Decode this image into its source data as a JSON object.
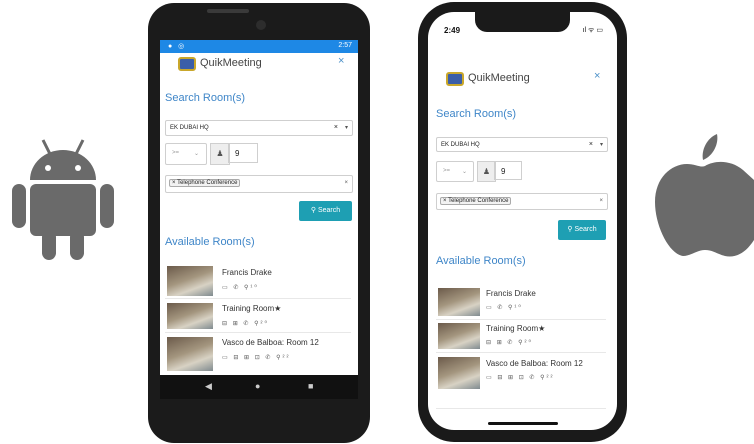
{
  "colors": {
    "accent": "#3f86c8",
    "button": "#1e9fb3",
    "android_status": "#1e88e5"
  },
  "android": {
    "status_time": "2:57",
    "app": {
      "brand": "QuikMeeting",
      "close": "×",
      "search_title": "Search Room(s)",
      "location": "EK DUBAI HQ",
      "operator": ">=",
      "capacity": "9",
      "amenity_chip": "× Telephone Conference",
      "search_button": "Search",
      "available_title": "Available Room(s)",
      "rooms": [
        {
          "name": "Francis Drake",
          "amenities": "▭ ✆ ⚲¹⁰"
        },
        {
          "name": "Training Room★",
          "amenities": "⊟ ⊞ ✆ ⚲²⁰"
        },
        {
          "name": "Vasco de Balboa: Room 12",
          "amenities": "▭ ⊟ ⊞ ⊡ ✆ ⚲²²"
        }
      ]
    }
  },
  "ios": {
    "status_time": "2:49",
    "app": {
      "brand": "QuikMeeting",
      "close": "×",
      "search_title": "Search Room(s)",
      "location": "EK DUBAI HQ",
      "operator": ">=",
      "capacity": "9",
      "amenity_chip": "× Telephone Conference",
      "search_button": "Search",
      "available_title": "Available Room(s)",
      "rooms": [
        {
          "name": "Francis Drake",
          "amenities": "▭ ✆ ⚲¹⁰"
        },
        {
          "name": "Training Room★",
          "amenities": "⊟ ⊞ ✆ ⚲²⁰"
        },
        {
          "name": "Vasco de Balboa: Room 12",
          "amenities": "▭ ⊟ ⊞ ⊡ ✆ ⚲²²"
        }
      ]
    }
  },
  "icons": [
    "android-logo-icon",
    "apple-logo-icon",
    "search-icon",
    "user-icon",
    "close-icon",
    "chevron-down-icon"
  ]
}
